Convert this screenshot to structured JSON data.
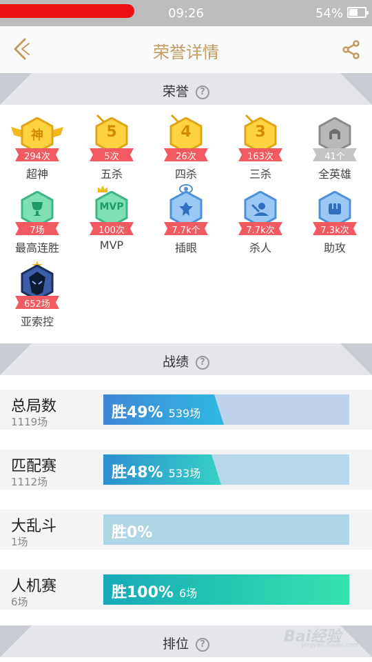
{
  "status_bar": {
    "time": "09:26",
    "battery": "54%"
  },
  "header": {
    "title": "荣誉详情"
  },
  "sections": {
    "honor": "荣誉",
    "record": "战绩",
    "rank": "排位",
    "help_glyph": "?"
  },
  "honors": [
    {
      "name": "超神",
      "count": "294次",
      "glyph": "神",
      "color": "#ffd23f",
      "accent": "#e0a418"
    },
    {
      "name": "五杀",
      "count": "5次",
      "glyph": "5",
      "color": "#ffd23f",
      "accent": "#e0a418"
    },
    {
      "name": "四杀",
      "count": "26次",
      "glyph": "4",
      "color": "#ffd23f",
      "accent": "#e0a418"
    },
    {
      "name": "三杀",
      "count": "163次",
      "glyph": "3",
      "color": "#ffd23f",
      "accent": "#e0a418"
    },
    {
      "name": "全英雄",
      "count": "41个",
      "glyph": "",
      "color": "#b8b8b8",
      "accent": "#8a8a8a"
    },
    {
      "name": "最高连胜",
      "count": "7场",
      "glyph": "",
      "color": "#7fe0b5",
      "accent": "#3fb486"
    },
    {
      "name": "MVP",
      "count": "100次",
      "glyph": "MVP",
      "color": "#7fe0b5",
      "accent": "#3fb486"
    },
    {
      "name": "插眼",
      "count": "7.7k个",
      "glyph": "",
      "color": "#9cc8f5",
      "accent": "#4f8fd8"
    },
    {
      "name": "杀人",
      "count": "7.7k次",
      "glyph": "",
      "color": "#9cc8f5",
      "accent": "#4f8fd8"
    },
    {
      "name": "助攻",
      "count": "7.3k次",
      "glyph": "",
      "color": "#9cc8f5",
      "accent": "#4f8fd8"
    },
    {
      "name": "亚索控",
      "count": "652场",
      "glyph": "",
      "color": "#3c5ea8",
      "accent": "#1b2d5a"
    }
  ],
  "stats": [
    {
      "name": "总局数",
      "count": "1119场",
      "rate_label": "胜49%",
      "games": "539场",
      "win_rate": 0.49
    },
    {
      "name": "匹配赛",
      "count": "1112场",
      "rate_label": "胜48%",
      "games": "533场",
      "win_rate": 0.48
    },
    {
      "name": "大乱斗",
      "count": "1场",
      "rate_label": "胜0%",
      "games": "",
      "win_rate": 0.0
    },
    {
      "name": "人机赛",
      "count": "6场",
      "rate_label": "胜100%",
      "games": "6场",
      "win_rate": 1.0
    }
  ],
  "watermark": {
    "brand": "Bai经验",
    "url": "jingyan.baidu.com"
  }
}
